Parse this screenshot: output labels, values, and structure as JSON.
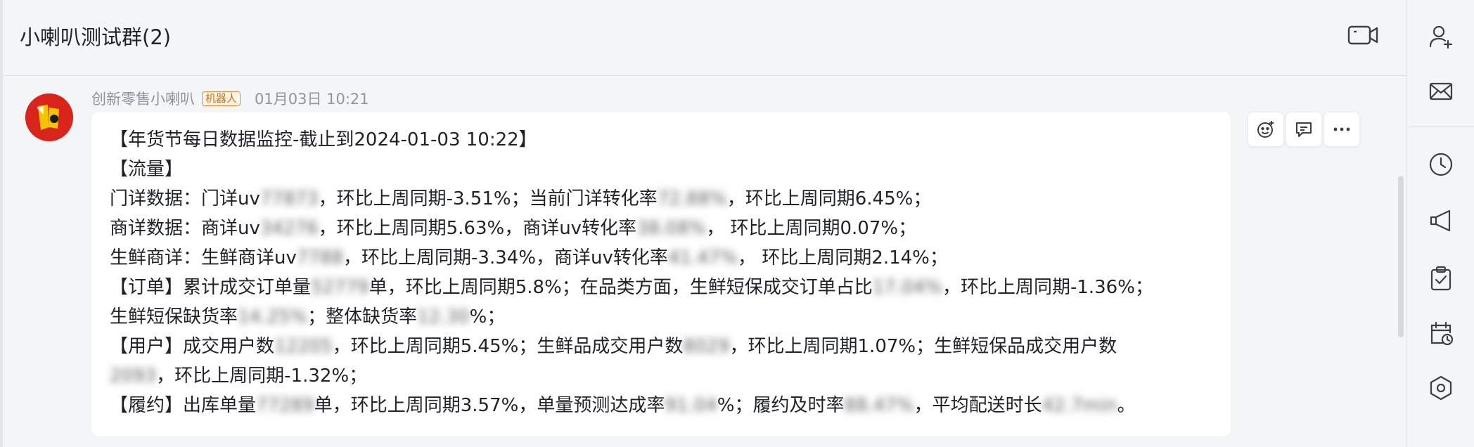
{
  "chat": {
    "title": "小喇叭测试群(2)"
  },
  "message": {
    "sender": "创新零售小喇叭",
    "badge": "机器人",
    "timestamp": "01月03日 10:21",
    "lines": [
      {
        "t": "【年货节每日数据监控-截止到2024-01-03 10:22】"
      },
      {
        "t": "【流量】"
      },
      {
        "parts": [
          "  门详数据：门详uv",
          "77873",
          "，环比上周同期-3.51%；当前门详转化率",
          "72.88%",
          "，环比上周同期6.45%；"
        ]
      },
      {
        "parts": [
          "  商详数据：商详uv",
          "34276",
          "，环比上周同期5.63%，商详uv转化率",
          "38.08%",
          "，  环比上周同期0.07%；"
        ]
      },
      {
        "parts": [
          "  生鲜商详：生鲜商详uv",
          "7788",
          "，环比上周同期-3.34%，商详uv转化率",
          "41.47%",
          "，  环比上周同期2.14%；"
        ]
      },
      {
        "parts": [
          "【订单】累计成交订单量",
          "52779",
          "单，环比上周同期5.8%；在品类方面，生鲜短保成交订单占比",
          "17.04%",
          "，环比上周同期-1.36%；"
        ]
      },
      {
        "parts": [
          "生鲜短保缺货率",
          "14.25%",
          "；整体缺货率",
          "12.30",
          "%；"
        ]
      },
      {
        "parts": [
          "【用户】成交用户数",
          "12205",
          "，环比上周同期5.45%；生鲜品成交用户数",
          "8029",
          "，环比上周同期1.07%；生鲜短保品成交用户数"
        ]
      },
      {
        "parts": [
          "",
          "2093",
          "，环比上周同期-1.32%；"
        ]
      },
      {
        "parts": [
          "【履约】出库单量",
          "77289",
          "单，环比上周同期3.57%，单量预测达成率",
          "91.04",
          "%；履约及时率",
          "88.47%",
          "，平均配送时长",
          "42.7min",
          "。"
        ]
      }
    ]
  },
  "icons": {
    "video": "video-call-icon",
    "emoji": "emoji-reaction-icon",
    "reply": "reply-comment-icon",
    "more": "more-options-icon",
    "add_member": "add-member-icon",
    "mail": "mail-icon",
    "clock": "history-clock-icon",
    "announce": "announcement-icon",
    "task": "task-clipboard-icon",
    "calendar": "calendar-icon",
    "settings": "settings-icon"
  },
  "colors": {
    "avatar_bg": "#d9241c",
    "badge": "#d96b00",
    "meta_gray": "#8f959e"
  }
}
